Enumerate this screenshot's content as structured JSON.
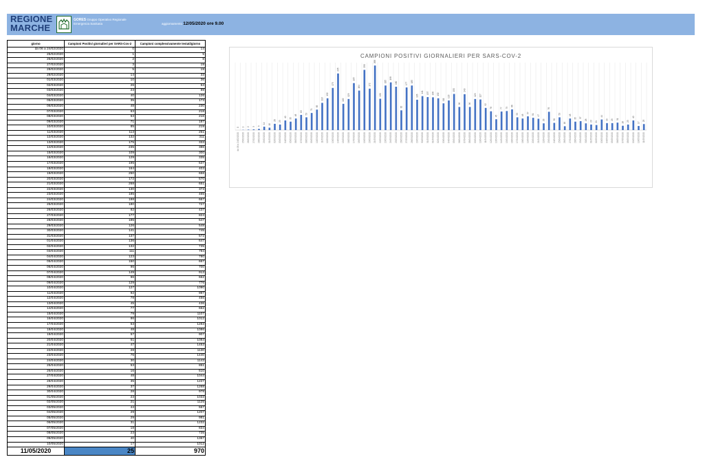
{
  "header": {
    "logo_line1": "REGIONE",
    "logo_line2": "MARCHE",
    "org_name": "GORES",
    "org_desc1": "Gruppo Operativo Regionale",
    "org_desc2": "Emergenza Sanitaria",
    "update_label": "aggiornamento",
    "update_value": "12/05/2020 ore 9.00"
  },
  "table": {
    "columns": [
      "giorno",
      "Campioni Positivi giornalieri per SARS-Cov-2",
      "Campioni complessivamente testati/giorno"
    ],
    "rows": [
      [
        "da 06 a 24/02/2020",
        "0",
        "14"
      ],
      [
        "25/02/2020",
        "1",
        "5"
      ],
      [
        "26/02/2020",
        "2",
        "8"
      ],
      [
        "27/02/2020",
        "3",
        "19"
      ],
      [
        "28/02/2020",
        "5",
        "19"
      ],
      [
        "29/02/2020",
        "14",
        "33"
      ],
      [
        "01/03/2020",
        "10",
        "36"
      ],
      [
        "02/03/2020",
        "26",
        "64"
      ],
      [
        "03/03/2020",
        "23",
        "89"
      ],
      [
        "04/03/2020",
        "40",
        "126"
      ],
      [
        "05/03/2020",
        "35",
        "173"
      ],
      [
        "06/03/2020",
        "48",
        "230"
      ],
      [
        "07/03/2020",
        "63",
        "218"
      ],
      [
        "08/03/2020",
        "53",
        "216"
      ],
      [
        "09/03/2020",
        "71",
        "187"
      ],
      [
        "10/03/2020",
        "85",
        "219"
      ],
      [
        "11/03/2020",
        "113",
        "251"
      ],
      [
        "12/03/2020",
        "132",
        "311"
      ],
      [
        "13/03/2020",
        "175",
        "333"
      ],
      [
        "14/03/2020",
        "235",
        "386"
      ],
      [
        "15/03/2020",
        "109",
        "300"
      ],
      [
        "16/03/2020",
        "129",
        "335"
      ],
      [
        "17/03/2020",
        "195",
        "537"
      ],
      [
        "18/03/2020",
        "164",
        "403"
      ],
      [
        "19/03/2020",
        "250",
        "658"
      ],
      [
        "20/03/2020",
        "172",
        "570"
      ],
      [
        "21/03/2020",
        "268",
        "651"
      ],
      [
        "22/03/2020",
        "130",
        "373"
      ],
      [
        "23/03/2020",
        "185",
        "465"
      ],
      [
        "24/03/2020",
        "198",
        "667"
      ],
      [
        "25/03/2020",
        "180",
        "727"
      ],
      [
        "26/03/2020",
        "82",
        "437"
      ],
      [
        "27/03/2020",
        "177",
        "824"
      ],
      [
        "28/03/2020",
        "185",
        "547"
      ],
      [
        "29/03/2020",
        "126",
        "548"
      ],
      [
        "30/03/2020",
        "141",
        "745"
      ],
      [
        "31/03/2020",
        "137",
        "572"
      ],
      [
        "01/04/2020",
        "136",
        "647"
      ],
      [
        "02/04/2020",
        "132",
        "735"
      ],
      [
        "03/04/2020",
        "111",
        "794"
      ],
      [
        "04/04/2020",
        "123",
        "780"
      ],
      [
        "05/04/2020",
        "150",
        "667"
      ],
      [
        "06/04/2020",
        "96",
        "700"
      ],
      [
        "07/04/2020",
        "149",
        "913"
      ],
      [
        "08/04/2020",
        "96",
        "662"
      ],
      [
        "09/04/2020",
        "129",
        "776"
      ],
      [
        "10/04/2020",
        "127",
        "1090"
      ],
      [
        "11/04/2020",
        "92",
        "997"
      ],
      [
        "12/04/2020",
        "78",
        "456"
      ],
      [
        "13/04/2020",
        "45",
        "436"
      ],
      [
        "14/04/2020",
        "77",
        "662"
      ],
      [
        "15/04/2020",
        "79",
        "1107"
      ],
      [
        "16/04/2020",
        "86",
        "1012"
      ],
      [
        "17/04/2020",
        "53",
        "1283"
      ],
      [
        "18/04/2020",
        "48",
        "1086"
      ],
      [
        "19/04/2020",
        "57",
        "907"
      ],
      [
        "20/04/2020",
        "51",
        "1084"
      ],
      [
        "21/04/2020",
        "47",
        "1453"
      ],
      [
        "22/04/2020",
        "28",
        "1130"
      ],
      [
        "23/04/2020",
        "76",
        "1440"
      ],
      [
        "24/04/2020",
        "30",
        "1143"
      ],
      [
        "25/04/2020",
        "53",
        "851"
      ],
      [
        "26/04/2020",
        "16",
        "510"
      ],
      [
        "27/04/2020",
        "48",
        "1044"
      ],
      [
        "28/04/2020",
        "35",
        "1227"
      ],
      [
        "29/04/2020",
        "37",
        "1268"
      ],
      [
        "30/04/2020",
        "28",
        "978"
      ],
      [
        "01/05/2020",
        "23",
        "1033"
      ],
      [
        "02/05/2020",
        "21",
        "1125"
      ],
      [
        "03/05/2020",
        "44",
        "557"
      ],
      [
        "04/05/2020",
        "29",
        "1207"
      ],
      [
        "05/05/2020",
        "29",
        "981"
      ],
      [
        "06/05/2020",
        "31",
        "1232"
      ],
      [
        "07/05/2020",
        "18",
        "834"
      ],
      [
        "08/05/2020",
        "23",
        "735"
      ],
      [
        "09/05/2020",
        "40",
        "1367"
      ],
      [
        "10/05/2020",
        "17",
        "1012"
      ]
    ],
    "last_row": [
      "11/05/2020",
      "25",
      "970"
    ]
  },
  "chart_data": {
    "type": "bar",
    "title": "CAMPIONI POSITIVI GIORNALIERI PER SARS-COV-2",
    "xlabel": "",
    "ylabel": "",
    "grid": true,
    "bar_color": "#4472c4",
    "categories": [
      "da 06 a 24/02/2020",
      "25/02/2020",
      "26/02/2020",
      "27/02/2020",
      "28/02/2020",
      "29/02/2020",
      "01/03/2020",
      "02/03/2020",
      "03/03/2020",
      "04/03/2020",
      "05/03/2020",
      "06/03/2020",
      "07/03/2020",
      "08/03/2020",
      "09/03/2020",
      "10/03/2020",
      "11/03/2020",
      "12/03/2020",
      "13/03/2020",
      "14/03/2020",
      "15/03/2020",
      "16/03/2020",
      "17/03/2020",
      "18/03/2020",
      "19/03/2020",
      "20/03/2020",
      "21/03/2020",
      "22/03/2020",
      "23/03/2020",
      "24/03/2020",
      "25/03/2020",
      "26/03/2020",
      "27/03/2020",
      "28/03/2020",
      "29/03/2020",
      "30/03/2020",
      "31/03/2020",
      "01/04/2020",
      "02/04/2020",
      "03/04/2020",
      "04/04/2020",
      "05/04/2020",
      "06/04/2020",
      "07/04/2020",
      "08/04/2020",
      "09/04/2020",
      "10/04/2020",
      "11/04/2020",
      "12/04/2020",
      "13/04/2020",
      "14/04/2020",
      "15/04/2020",
      "16/04/2020",
      "17/04/2020",
      "18/04/2020",
      "19/04/2020",
      "20/04/2020",
      "21/04/2020",
      "22/04/2020",
      "23/04/2020",
      "24/04/2020",
      "25/04/2020",
      "26/04/2020",
      "27/04/2020",
      "28/04/2020",
      "29/04/2020",
      "30/04/2020",
      "01/05/2020",
      "02/05/2020",
      "03/05/2020",
      "04/05/2020",
      "05/05/2020",
      "06/05/2020",
      "07/05/2020",
      "08/05/2020",
      "09/05/2020",
      "10/05/2020",
      "11/05/2020"
    ],
    "values": [
      0,
      1,
      2,
      3,
      5,
      14,
      10,
      26,
      23,
      40,
      35,
      48,
      63,
      53,
      71,
      85,
      113,
      132,
      175,
      235,
      109,
      129,
      195,
      164,
      250,
      172,
      268,
      130,
      185,
      198,
      180,
      82,
      177,
      185,
      126,
      141,
      137,
      136,
      132,
      111,
      123,
      150,
      96,
      149,
      96,
      129,
      127,
      92,
      78,
      45,
      77,
      79,
      86,
      53,
      48,
      57,
      51,
      47,
      28,
      76,
      30,
      53,
      16,
      48,
      35,
      37,
      28,
      23,
      21,
      44,
      29,
      29,
      31,
      18,
      23,
      40,
      17,
      25
    ],
    "ylim": [
      0,
      280
    ]
  }
}
